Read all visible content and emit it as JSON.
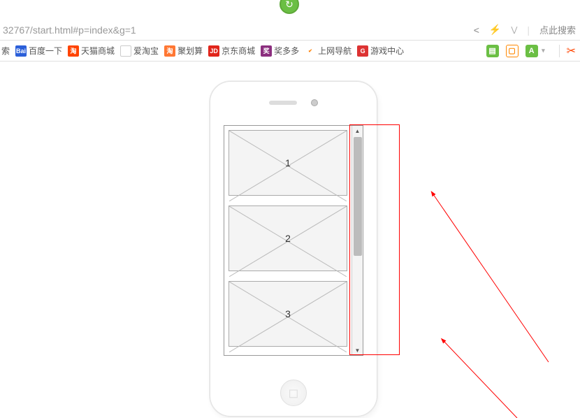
{
  "url_bar": {
    "text": "32767/start.html#p=index&g=1",
    "search_placeholder": "点此搜索"
  },
  "bookmarks": {
    "items": [
      {
        "label": "索",
        "icon": ""
      },
      {
        "label": "百度一下",
        "icon": "Bai"
      },
      {
        "label": "天猫商城",
        "icon": "淘"
      },
      {
        "label": "爱淘宝",
        "icon": ""
      },
      {
        "label": "聚划算",
        "icon": "淘"
      },
      {
        "label": "京东商城",
        "icon": "JD"
      },
      {
        "label": "奖多多",
        "icon": "奖"
      },
      {
        "label": "上网导航",
        "icon": "hao"
      },
      {
        "label": "游戏中心",
        "icon": "G"
      }
    ]
  },
  "phone": {
    "cards": [
      "1",
      "2",
      "3"
    ]
  }
}
